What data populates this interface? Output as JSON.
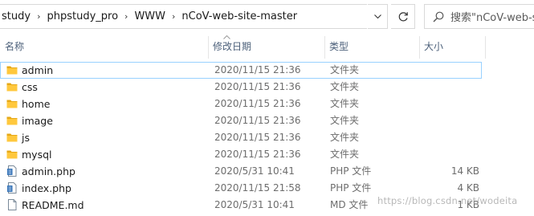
{
  "address_bar": {
    "crumbs": [
      "study",
      "phpstudy_pro",
      "WWW",
      "nCoV-web-site-master"
    ],
    "separator": "›",
    "dropdown_icon": "chevron-down-icon",
    "refresh_icon": "refresh-icon"
  },
  "search": {
    "placeholder": "搜索\"nCoV-web-site...",
    "icon": "search-icon"
  },
  "columns": {
    "name": "名称",
    "date": "修改日期",
    "type": "类型",
    "size": "大小"
  },
  "files": [
    {
      "name": "admin",
      "date": "2020/11/15 21:36",
      "type": "文件夹",
      "size": "",
      "icon": "folder-icon"
    },
    {
      "name": "css",
      "date": "2020/11/15 21:36",
      "type": "文件夹",
      "size": "",
      "icon": "folder-icon"
    },
    {
      "name": "home",
      "date": "2020/11/15 21:36",
      "type": "文件夹",
      "size": "",
      "icon": "folder-icon"
    },
    {
      "name": "image",
      "date": "2020/11/15 21:36",
      "type": "文件夹",
      "size": "",
      "icon": "folder-icon"
    },
    {
      "name": "js",
      "date": "2020/11/15 21:36",
      "type": "文件夹",
      "size": "",
      "icon": "folder-icon"
    },
    {
      "name": "mysql",
      "date": "2020/11/15 21:36",
      "type": "文件夹",
      "size": "",
      "icon": "folder-icon"
    },
    {
      "name": "admin.php",
      "date": "2020/5/31 10:41",
      "type": "PHP 文件",
      "size": "14 KB",
      "icon": "php-file-icon"
    },
    {
      "name": "index.php",
      "date": "2020/11/15 21:58",
      "type": "PHP 文件",
      "size": "4 KB",
      "icon": "php-file-icon"
    },
    {
      "name": "README.md",
      "date": "2020/5/31 10:41",
      "type": "MD 文件",
      "size": "1 KB",
      "icon": "document-file-icon"
    }
  ],
  "watermark": "https://blog.csdn.net/wodeita",
  "colors": {
    "folder": "#ffc83d",
    "folder_dark": "#e6a817",
    "focus_outline": "#99d1ff",
    "header_text": "#4c607a",
    "meta_text": "#6d6d6d"
  }
}
